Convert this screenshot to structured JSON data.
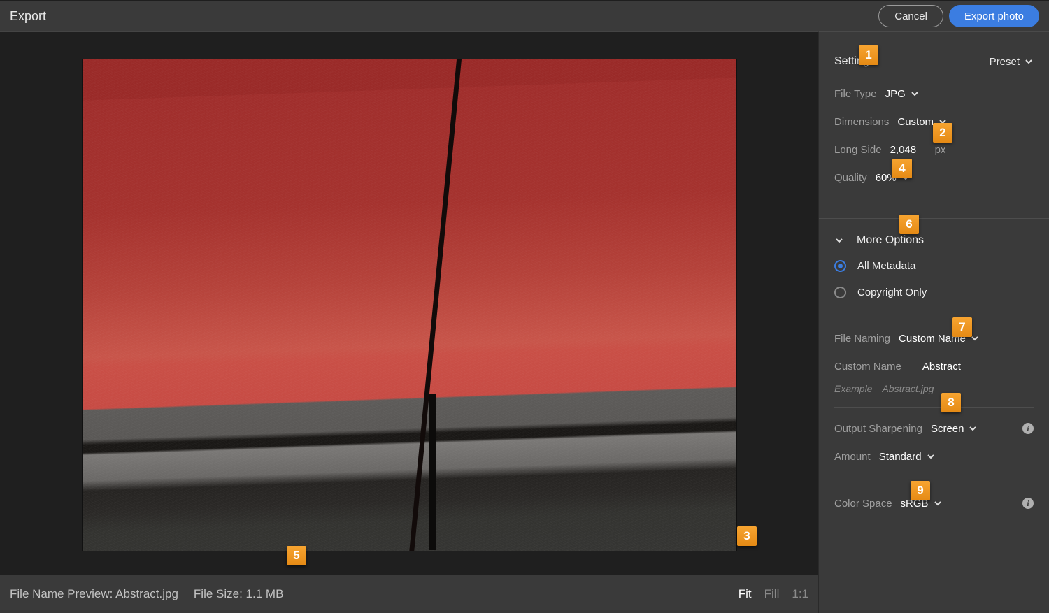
{
  "header": {
    "title": "Export",
    "cancel": "Cancel",
    "export": "Export photo"
  },
  "settings": {
    "heading": "Settings",
    "preset_label": "Preset",
    "file_type_label": "File Type",
    "file_type_value": "JPG",
    "dimensions_label": "Dimensions",
    "dimensions_value": "Custom",
    "long_side_label": "Long Side",
    "long_side_value": "2,048",
    "long_side_unit": "px",
    "quality_label": "Quality",
    "quality_value": "60%"
  },
  "more": {
    "heading": "More Options",
    "radio_all": "All Metadata",
    "radio_copyright": "Copyright Only"
  },
  "naming": {
    "label": "File Naming",
    "value": "Custom Name",
    "custom_label": "Custom Name",
    "custom_value": "Abstract",
    "example_label": "Example",
    "example_value": "Abstract.jpg"
  },
  "sharpen": {
    "label": "Output Sharpening",
    "value": "Screen",
    "amount_label": "Amount",
    "amount_value": "Standard"
  },
  "colorspace": {
    "label": "Color Space",
    "value": "sRGB"
  },
  "footer": {
    "file_name_preview": "File Name Preview: Abstract.jpg",
    "file_size": "File Size: 1.1 MB",
    "fit": "Fit",
    "fill": "Fill",
    "one_to_one": "1:1"
  },
  "callouts": {
    "c1": "1",
    "c2": "2",
    "c3": "3",
    "c4": "4",
    "c5": "5",
    "c6": "6",
    "c7": "7",
    "c8": "8",
    "c9": "9"
  }
}
